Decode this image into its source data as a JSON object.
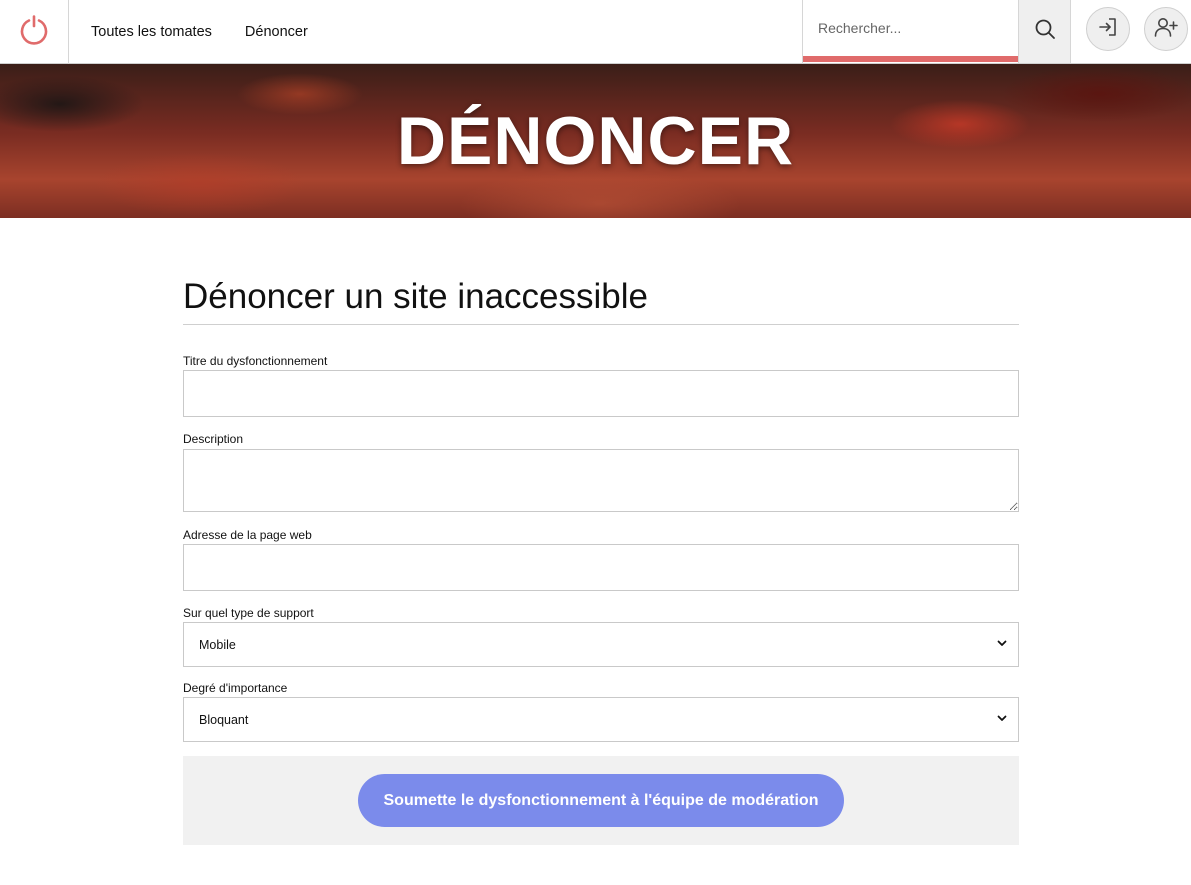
{
  "header": {
    "logo_icon": "power-icon",
    "nav": [
      {
        "label": "Toutes les tomates"
      },
      {
        "label": "Dénoncer"
      }
    ],
    "search": {
      "placeholder": "Rechercher...",
      "value": ""
    },
    "search_icon": "search-icon",
    "login_icon": "sign-in-icon",
    "register_icon": "user-plus-icon",
    "accent_color": "#e06b6b"
  },
  "hero": {
    "title": "DÉNONCER"
  },
  "form": {
    "title": "Dénoncer un site inaccessible",
    "fields": {
      "title_label": "Titre du dysfonctionnement",
      "description_label": "Description",
      "url_label": "Adresse de la page web",
      "support_label": "Sur quel type de support",
      "support_value": "Mobile",
      "importance_label": "Degré d'importance",
      "importance_value": "Bloquant"
    },
    "submit_label": "Soumette le dysfonctionnement à l'équipe de modération",
    "submit_color": "#7b8beb"
  }
}
